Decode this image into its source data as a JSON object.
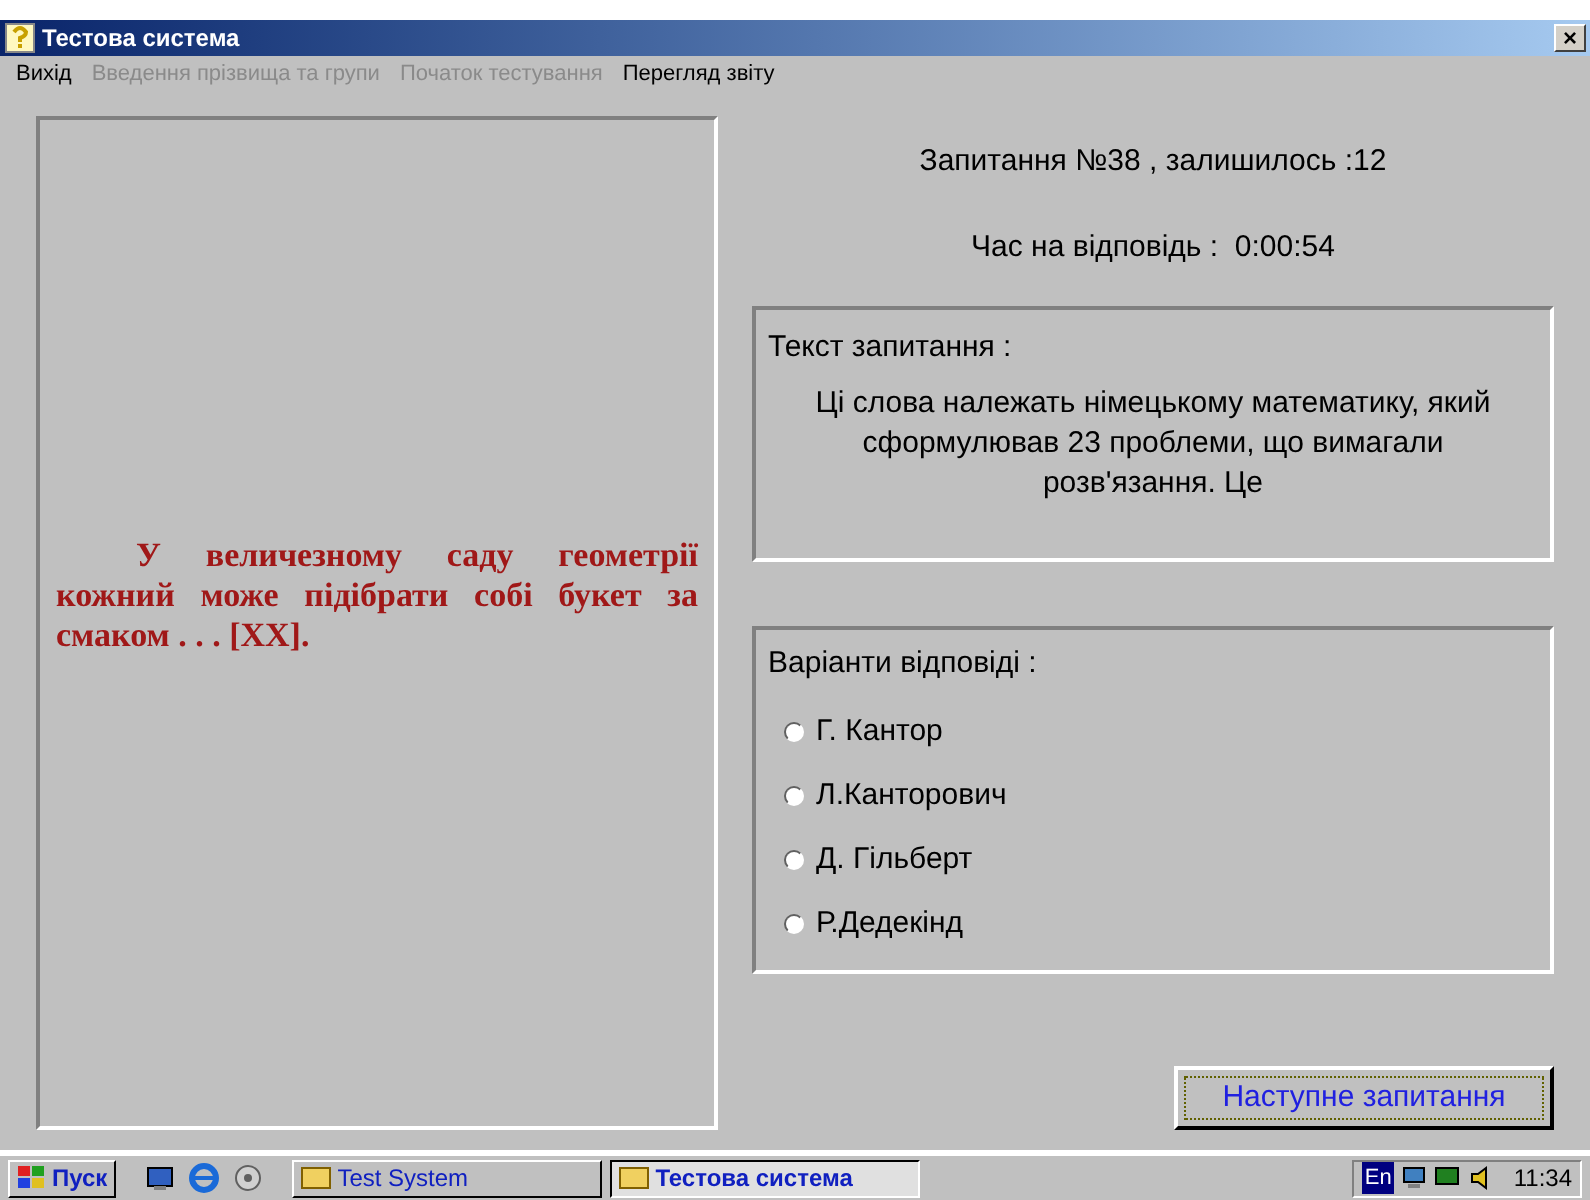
{
  "window": {
    "title": "Тестова система",
    "close": "×"
  },
  "menu": [
    {
      "label": "Вихід",
      "disabled": false
    },
    {
      "label": "Введення прізвища та групи",
      "disabled": true
    },
    {
      "label": "Початок тестування",
      "disabled": true
    },
    {
      "label": "Перегляд звіту",
      "disabled": false
    }
  ],
  "quote": "У величезному саду геометрії кожний може підібрати собі букет за смаком . . . [XX].",
  "question_counter": "Запитання №38 , залишилось :12",
  "timer": "Час на відповідь :  0:00:54",
  "question": {
    "label": "Текст запитання :",
    "text": "Ці слова належать німецькому математику, який сформулював 23 проблеми, що вимагали розв'язання. Це"
  },
  "answers": {
    "label": "Варіанти відповіді :",
    "options": [
      {
        "label": "Г. Кантор",
        "selected": false
      },
      {
        "label": "Л.Канторович",
        "selected": false
      },
      {
        "label": "Д. Гільберт",
        "selected": false
      },
      {
        "label": "Р.Дедекінд",
        "selected": false
      }
    ]
  },
  "next_button": "Наступне запитання",
  "taskbar": {
    "start": "Пуск",
    "tasks": [
      {
        "label": "Test System",
        "selected": false
      },
      {
        "label": "Тестова система",
        "selected": true
      }
    ],
    "language": "En",
    "clock": "11:34"
  }
}
